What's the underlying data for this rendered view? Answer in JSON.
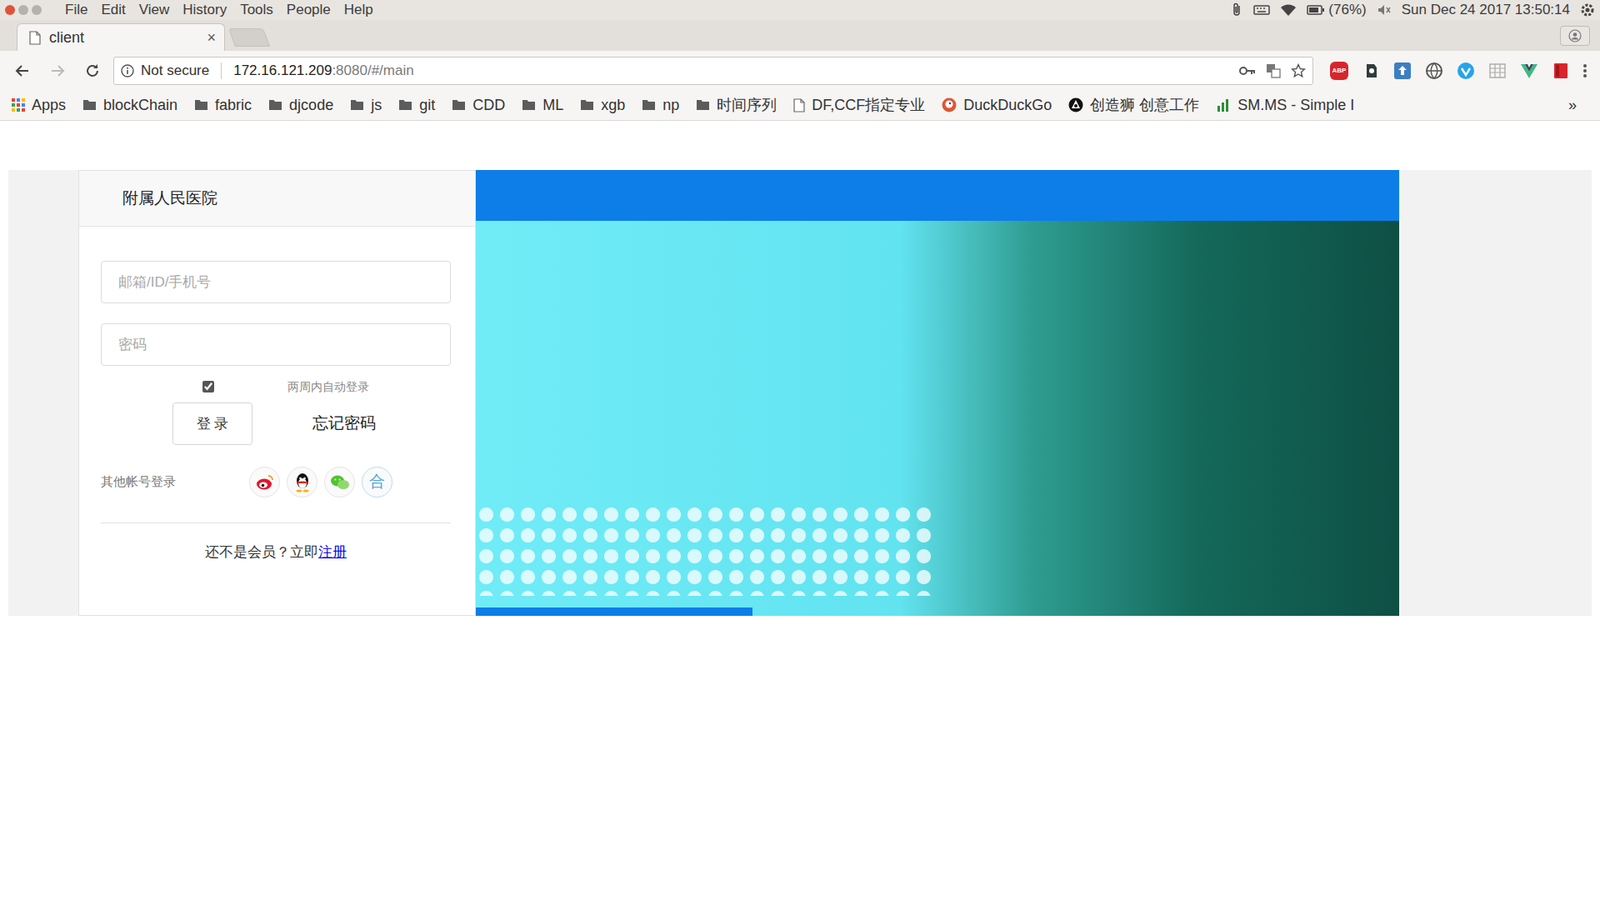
{
  "menubar": {
    "items": [
      "File",
      "Edit",
      "View",
      "History",
      "Tools",
      "People",
      "Help"
    ],
    "battery": "(76%)",
    "clock": "Sun Dec 24 2017 13:50:14"
  },
  "tabs": [
    {
      "label": "client",
      "selected": true,
      "close": "×"
    }
  ],
  "address": {
    "security": "Not secure",
    "host": "172.16.121.209",
    "rest": ":8080/#/main"
  },
  "extensions": [
    {
      "kind": "abp",
      "label": "ABP"
    },
    {
      "kind": "evernote"
    },
    {
      "kind": "upload"
    },
    {
      "kind": "globe"
    },
    {
      "kind": "vchat"
    },
    {
      "kind": "grid"
    },
    {
      "kind": "vue"
    },
    {
      "kind": "red"
    }
  ],
  "bookmarks": [
    {
      "label": "Apps",
      "kind": "apps"
    },
    {
      "label": "blockChain",
      "kind": "folder"
    },
    {
      "label": "fabric",
      "kind": "folder"
    },
    {
      "label": "djcode",
      "kind": "folder"
    },
    {
      "label": "js",
      "kind": "folder"
    },
    {
      "label": "git",
      "kind": "folder"
    },
    {
      "label": "CDD",
      "kind": "folder"
    },
    {
      "label": "ML",
      "kind": "folder"
    },
    {
      "label": "xgb",
      "kind": "folder"
    },
    {
      "label": "np",
      "kind": "folder"
    },
    {
      "label": "时间序列",
      "kind": "folder"
    },
    {
      "label": "DF,CCF指定专业",
      "kind": "page"
    },
    {
      "label": "DuckDuckGo",
      "kind": "duck"
    },
    {
      "label": "创造狮 创意工作",
      "kind": "lion"
    },
    {
      "label": "SM.MS - Simple I",
      "kind": "chart"
    }
  ],
  "bookmarks_more": "»",
  "login": {
    "hospital": "附属人民医院",
    "account_placeholder": "邮箱/ID/手机号",
    "password_placeholder": "密码",
    "remember": {
      "label": "两周内自动登录",
      "checked": true
    },
    "login_button": "登 录",
    "forgot": "忘记密码",
    "other_login": "其他帐号登录",
    "providers": [
      {
        "kind": "weibo"
      },
      {
        "kind": "qq"
      },
      {
        "kind": "wechat"
      },
      {
        "kind": "text",
        "label": "合"
      }
    ],
    "register_prompt": "还不是会员？立即",
    "register_link": "注册"
  }
}
